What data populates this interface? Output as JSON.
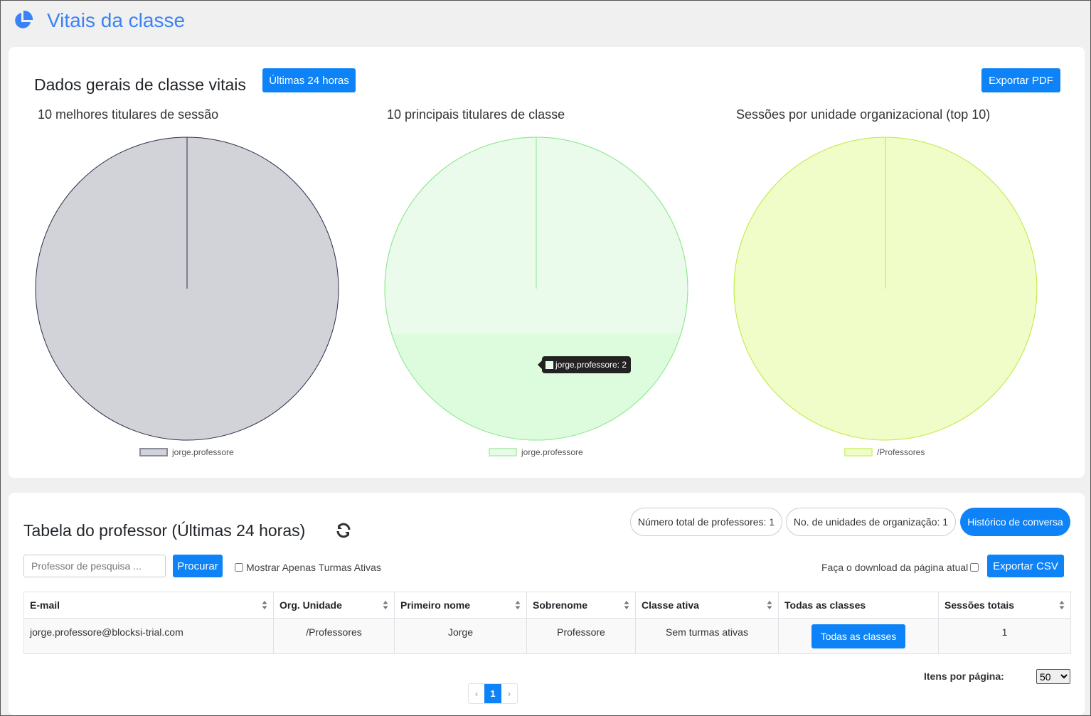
{
  "header": {
    "title": "Vitais da classe",
    "icon": "pie-chart-icon"
  },
  "overview": {
    "title": "Dados gerais de classe vitais",
    "range_button": "Últimas 24 horas",
    "export_pdf": "Exportar PDF"
  },
  "charts": [
    {
      "title": "10 melhores titulares de sessão",
      "legend": "jorge.professore",
      "color": "#d1d3d8",
      "stroke": "#2a2d4a"
    },
    {
      "title": "10 principais titulares de classe",
      "legend": "jorge.professore",
      "color": "#e8fbe8",
      "stroke": "#8ee88e"
    },
    {
      "title": "Sessões por unidade organizacional (top 10)",
      "legend": "/Professores",
      "color": "#f0fdc8",
      "stroke": "#bde83a"
    }
  ],
  "chart_data": [
    {
      "type": "pie",
      "title": "10 melhores titulares de sessão",
      "categories": [
        "jorge.professore"
      ],
      "values": [
        1
      ],
      "legend_placement": "bottom"
    },
    {
      "type": "pie",
      "title": "10 principais titulares de classe",
      "categories": [
        "jorge.professore"
      ],
      "values": [
        2
      ],
      "legend_placement": "bottom"
    },
    {
      "type": "pie",
      "title": "Sessões por unidade organizacional (top 10)",
      "categories": [
        "/Professores"
      ],
      "values": [
        1
      ],
      "legend_placement": "bottom"
    }
  ],
  "tooltip": {
    "text": "jorge.professore: 2"
  },
  "teacher_table": {
    "title": "Tabela do professor (Últimas 24 horas)",
    "refresh_icon": "refresh-icon",
    "total_teachers": "Número total de professores: 1",
    "org_units": "No. de unidades de organização: 1",
    "chat_history": "Histórico de conversa",
    "search_placeholder": "Professor de pesquisa ...",
    "search_button": "Procurar",
    "active_only": "Mostrar Apenas Turmas Ativas",
    "download_current": "Faça o download da página atual",
    "export_csv": "Exportar CSV",
    "columns": [
      "E-mail",
      "Org. Unidade",
      "Primeiro nome",
      "Sobrenome",
      "Classe ativa",
      "Todas as classes",
      "Sessões totais"
    ],
    "rows": [
      {
        "email": "jorge.professore@blocksi-trial.com",
        "org": "/Professores",
        "first": "Jorge",
        "last": "Professore",
        "active": "Sem turmas ativas",
        "all_classes": "Todas as classes",
        "sessions": "1"
      }
    ],
    "pagination": {
      "prev": "‹",
      "current": "1",
      "next": "›"
    },
    "per_page_label": "Itens por página:",
    "per_page_value": "50"
  }
}
